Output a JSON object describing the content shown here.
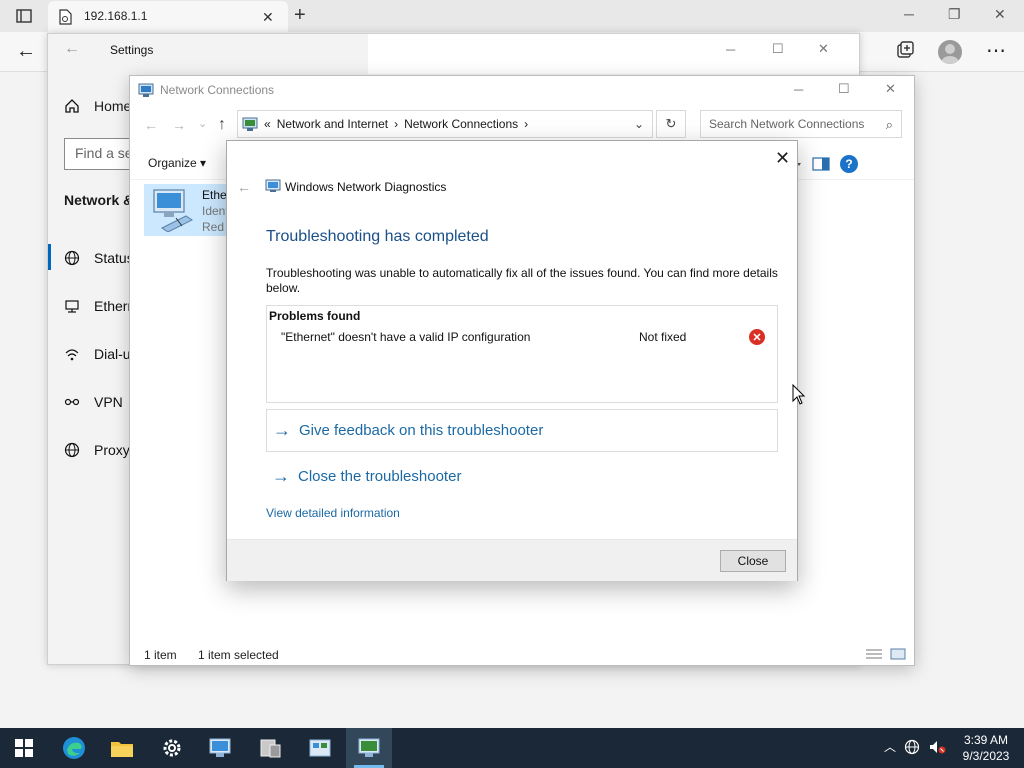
{
  "browser": {
    "tab_title": "192.168.1.1",
    "close_tab_glyph": "✕",
    "new_tab_glyph": "+",
    "minimize_glyph": "─",
    "restore_glyph": "❐",
    "close_glyph": "✕",
    "back_glyph": "←",
    "more_glyph": "⋯"
  },
  "settings": {
    "title": "Settings",
    "back_glyph": "←",
    "home_label": "Home",
    "search_placeholder": "Find a se",
    "section_label": "Network &",
    "nav_items": [
      {
        "label": "Status",
        "icon": "globe-icon"
      },
      {
        "label": "Ethern",
        "icon": "ethernet-icon"
      },
      {
        "label": "Dial-u",
        "icon": "dialup-icon"
      },
      {
        "label": "VPN",
        "icon": "vpn-icon"
      },
      {
        "label": "Proxy",
        "icon": "proxy-globe-icon"
      }
    ],
    "minimize_glyph": "─",
    "maximize_glyph": "☐",
    "close_glyph": "✕"
  },
  "network_connections": {
    "title": "Network Connections",
    "minimize_glyph": "─",
    "maximize_glyph": "☐",
    "close_glyph": "✕",
    "back_glyph": "←",
    "forward_glyph": "→",
    "recent_glyph": "⌄",
    "up_glyph": "↑",
    "breadcrumb_prefix": "«",
    "breadcrumb": [
      "Network and Internet",
      "Network Connections"
    ],
    "breadcrumb_sep": "›",
    "dropdown_glyph": "⌄",
    "refresh_glyph": "↻",
    "search_placeholder": "Search Network Connections",
    "search_glyph": "⌕",
    "organize_label": "Organize ▾",
    "help_glyph": "?",
    "ethernet_name": "Ether",
    "ethernet_ident": "Ident",
    "ethernet_red": "Red I",
    "status_count": "1 item",
    "status_selected": "1 item selected"
  },
  "diagnostics": {
    "close_x": "✕",
    "back_glyph": "←",
    "app_title": "Windows Network Diagnostics",
    "heading": "Troubleshooting has completed",
    "message": "Troubleshooting was unable to automatically fix all of the issues found. You can find more details below.",
    "problems_header": "Problems found",
    "problem_description": "\"Ethernet\" doesn't have a valid IP configuration",
    "problem_status": "Not fixed",
    "problem_status_glyph": "✕",
    "arrow_glyph": "→",
    "feedback_link": "Give feedback on this troubleshooter",
    "close_link": "Close the troubleshooter",
    "detail_link": "View detailed information",
    "close_button": "Close",
    "status_color": "#d93025",
    "link_color": "#1b6aa5"
  },
  "taskbar": {
    "tray_chevron": "︿",
    "time": "3:39 AM",
    "date": "9/3/2023",
    "accent": "#76b9ed"
  }
}
